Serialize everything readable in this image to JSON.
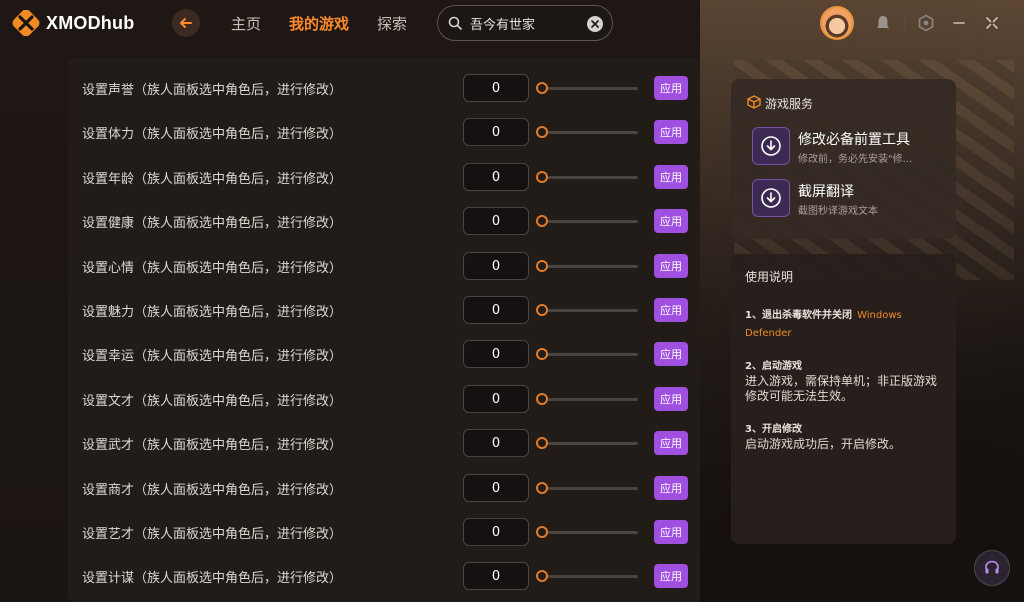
{
  "app": {
    "name": "XMODhub"
  },
  "nav": {
    "home": "主页",
    "my_games": "我的游戏",
    "explore": "探索"
  },
  "search": {
    "value": "吾今有世家"
  },
  "rows": [
    {
      "label": "设置声誉（族人面板选中角色后，进行修改）",
      "value": "0",
      "apply": "应用"
    },
    {
      "label": "设置体力（族人面板选中角色后，进行修改）",
      "value": "0",
      "apply": "应用"
    },
    {
      "label": "设置年龄（族人面板选中角色后，进行修改）",
      "value": "0",
      "apply": "应用"
    },
    {
      "label": "设置健康（族人面板选中角色后，进行修改）",
      "value": "0",
      "apply": "应用"
    },
    {
      "label": "设置心情（族人面板选中角色后，进行修改）",
      "value": "0",
      "apply": "应用"
    },
    {
      "label": "设置魅力（族人面板选中角色后，进行修改）",
      "value": "0",
      "apply": "应用"
    },
    {
      "label": "设置幸运（族人面板选中角色后，进行修改）",
      "value": "0",
      "apply": "应用"
    },
    {
      "label": "设置文才（族人面板选中角色后，进行修改）",
      "value": "0",
      "apply": "应用"
    },
    {
      "label": "设置武才（族人面板选中角色后，进行修改）",
      "value": "0",
      "apply": "应用"
    },
    {
      "label": "设置商才（族人面板选中角色后，进行修改）",
      "value": "0",
      "apply": "应用"
    },
    {
      "label": "设置艺才（族人面板选中角色后，进行修改）",
      "value": "0",
      "apply": "应用"
    },
    {
      "label": "设置计谋（族人面板选中角色后，进行修改）",
      "value": "0",
      "apply": "应用"
    }
  ],
  "services": {
    "title": "游戏服务",
    "items": [
      {
        "name": "修改必备前置工具",
        "desc": "修改前，务必先安装\"修...",
        "icon": "download-icon"
      },
      {
        "name": "截屏翻译",
        "desc": "截图秒译游戏文本",
        "icon": "download-icon"
      }
    ]
  },
  "help": {
    "title": "使用说明",
    "step1_head": "1、退出杀毒软件并关闭",
    "step1_highlight_a": "Windows",
    "step1_highlight_b": "Defender",
    "step2_head": "2、启动游戏",
    "step2_body": "进入游戏，需保持单机；非正版游戏修改可能无法生效。",
    "step3_head": "3、开启修改",
    "step3_body": "启动游戏成功后，开启修改。"
  },
  "colors": {
    "accent": "#ff8a2a",
    "apply": "#a050e0"
  }
}
